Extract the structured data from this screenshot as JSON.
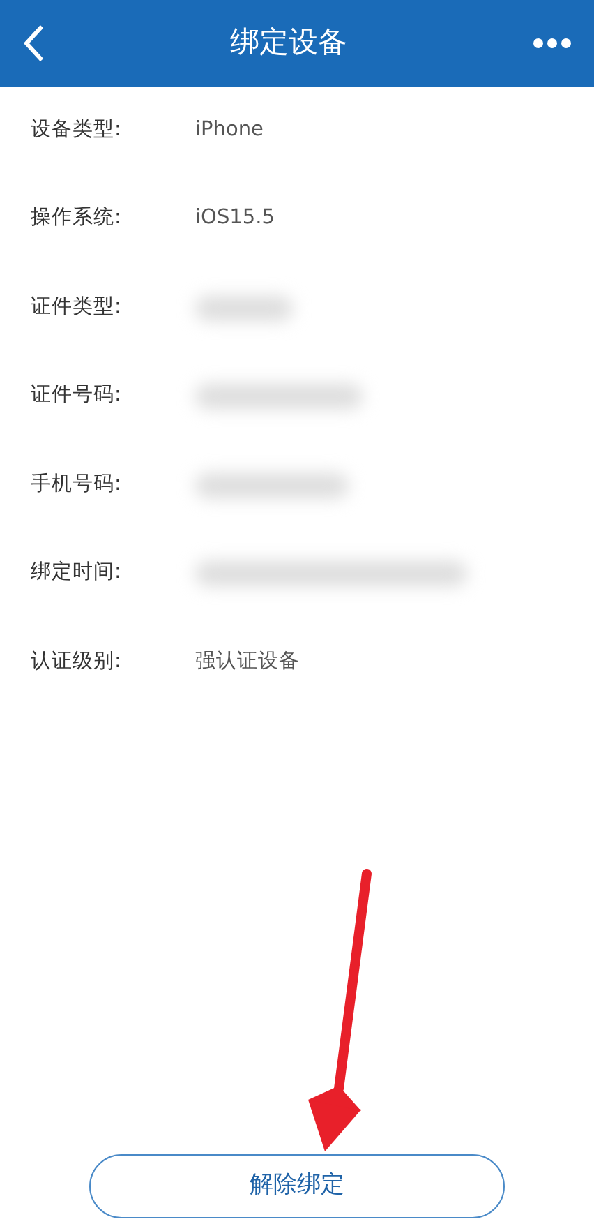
{
  "header": {
    "title": "绑定设备",
    "back_icon": true,
    "more_icon": true
  },
  "fields": [
    {
      "label": "设备类型:",
      "kind": "text",
      "value": "iPhone"
    },
    {
      "label": "操作系统:",
      "kind": "text",
      "value": "iOS15.5"
    },
    {
      "label": "证件类型:",
      "kind": "blurred"
    },
    {
      "label": "证件号码:",
      "kind": "blurred"
    },
    {
      "label": "手机号码:",
      "kind": "blurred"
    },
    {
      "label": "绑定时间:",
      "kind": "blurred"
    },
    {
      "label": "认证级别:",
      "kind": "text",
      "value": "强认证设备"
    }
  ],
  "annotation_arrow": true,
  "button": {
    "label": "解除绑定"
  }
}
